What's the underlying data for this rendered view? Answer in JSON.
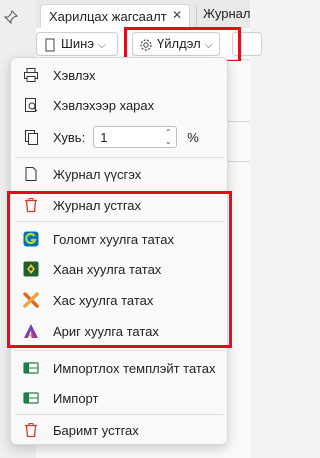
{
  "tabs": {
    "active_label": "Харилцах жагсаалт",
    "close_glyph": "✕",
    "other_label": "Журнал"
  },
  "toolbar": {
    "share_label": "Шинэ",
    "action_label": "Үйлдэл"
  },
  "menu": {
    "print": "Хэвлэх",
    "print_preview": "Хэвлэхээр харах",
    "copies_label": "Хувь:",
    "copies_value": "1",
    "copies_unit": "%",
    "create_journal": "Журнал үүсгэх",
    "delete_journal": "Журнал устгах",
    "golomt": "Голомт хуулга татах",
    "khan": "Хаан хуулга татах",
    "khas": "Хас хуулга татах",
    "arig": "Ариг хуулга татах",
    "import_template": "Импортлох темплэйт татах",
    "import": "Импорт",
    "delete_document": "Баримт устгах"
  },
  "colors": {
    "highlight": "#e0101a",
    "danger_icon": "#d23b2c",
    "golomt": "#0a6db5",
    "khan": "#1f5e2e",
    "khas": "#e06a1a",
    "arig": "#7a3fb8",
    "excel": "#1e7e45"
  }
}
